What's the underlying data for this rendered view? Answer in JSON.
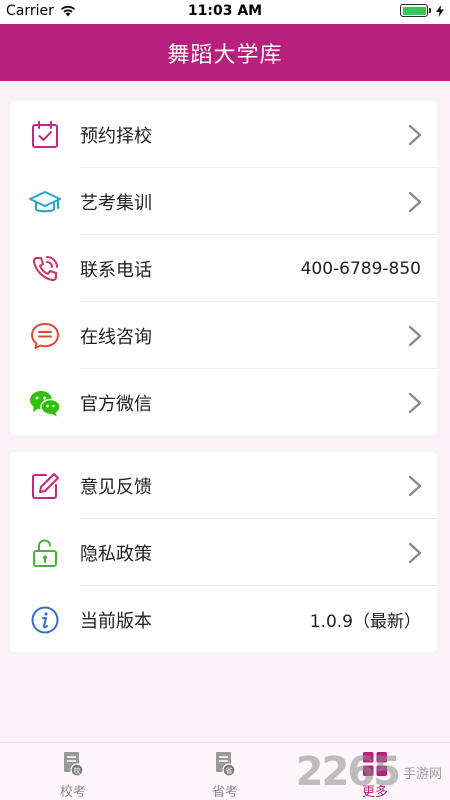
{
  "status_bar": {
    "carrier": "Carrier",
    "time": "11:03 AM"
  },
  "header": {
    "title": "舞蹈大学库"
  },
  "menu_group_1": [
    {
      "label": "预约择校",
      "icon": "calendar-check-icon",
      "value": ""
    },
    {
      "label": "艺考集训",
      "icon": "graduation-cap-icon",
      "value": ""
    },
    {
      "label": "联系电话",
      "icon": "phone-icon",
      "value": "400-6789-850"
    },
    {
      "label": "在线咨询",
      "icon": "chat-bubble-icon",
      "value": ""
    },
    {
      "label": "官方微信",
      "icon": "wechat-icon",
      "value": ""
    }
  ],
  "menu_group_2": [
    {
      "label": "意见反馈",
      "icon": "edit-icon",
      "value": ""
    },
    {
      "label": "隐私政策",
      "icon": "unlock-icon",
      "value": ""
    },
    {
      "label": "当前版本",
      "icon": "info-icon",
      "value": "1.0.9（最新）"
    }
  ],
  "tabbar": {
    "tabs": [
      {
        "label": "校考",
        "icon": "school-exam-icon",
        "active": false
      },
      {
        "label": "省考",
        "icon": "province-exam-icon",
        "active": false
      },
      {
        "label": "更多",
        "icon": "grid-more-icon",
        "active": true
      }
    ]
  },
  "watermark": {
    "number": "2265",
    "text": "手游网"
  },
  "colors": {
    "brand": "#b8207d",
    "background": "#fbf2f8",
    "wechat": "#2dc100"
  }
}
